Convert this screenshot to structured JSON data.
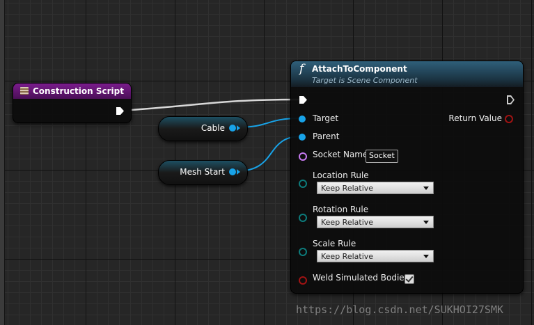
{
  "construction_node": {
    "title": "Construction Script",
    "icon": "construction-script-icon"
  },
  "variables": {
    "cable": "Cable",
    "mesh_start": "Mesh Start"
  },
  "attach_node": {
    "icon": "f",
    "title": "AttachToComponent",
    "subtitle": "Target is Scene Component",
    "pins": {
      "target": "Target",
      "parent": "Parent",
      "socket_name": "Socket Name",
      "socket_value": "Socket",
      "location_rule": "Location Rule",
      "location_value": "Keep Relative",
      "rotation_rule": "Rotation Rule",
      "rotation_value": "Keep Relative",
      "scale_rule": "Scale Rule",
      "scale_value": "Keep Relative",
      "weld": "Weld Simulated Bodies",
      "weld_checked": true,
      "return_value": "Return Value"
    }
  },
  "colors": {
    "object_pin": "#18a3e8",
    "name_pin": "#c67af0",
    "enum_pin": "#0d7b7b",
    "bool_pin": "#a11313",
    "exec": "#ffffff",
    "construction_header": "#6a1a7c"
  },
  "watermark": "https://blog.csdn.net/SUKHOI27SMK"
}
